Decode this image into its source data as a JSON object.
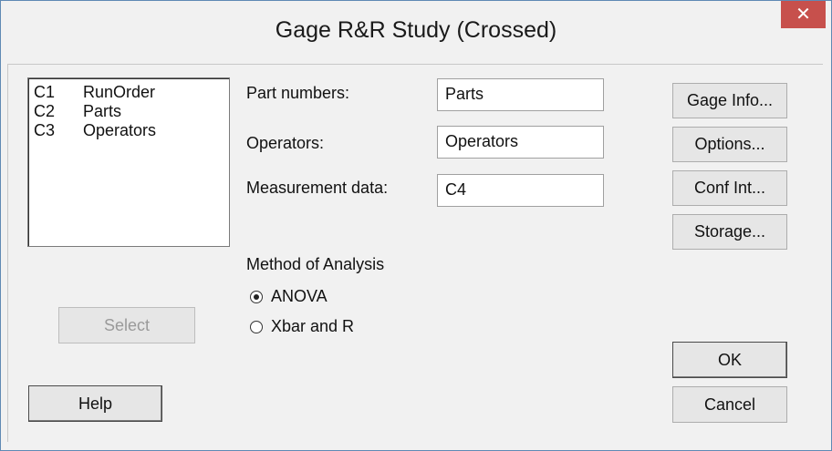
{
  "window": {
    "title": "Gage R&R Study (Crossed)",
    "close_glyph": "✕"
  },
  "columns": [
    {
      "id": "C1",
      "name": "RunOrder"
    },
    {
      "id": "C2",
      "name": "Parts"
    },
    {
      "id": "C3",
      "name": "Operators"
    }
  ],
  "fields": {
    "part_numbers": {
      "label": "Part numbers:",
      "value": "Parts"
    },
    "operators": {
      "label": "Operators:",
      "value": "Operators"
    },
    "measurement": {
      "label": "Measurement data:",
      "value": "C4"
    }
  },
  "method": {
    "label": "Method of Analysis",
    "options": [
      {
        "label": "ANOVA",
        "selected": true
      },
      {
        "label": "Xbar and R",
        "selected": false
      }
    ]
  },
  "buttons": {
    "gage_info": "Gage Info...",
    "options": "Options...",
    "conf_int": "Conf Int...",
    "storage": "Storage...",
    "select": "Select",
    "help": "Help",
    "ok": "OK",
    "cancel": "Cancel"
  }
}
